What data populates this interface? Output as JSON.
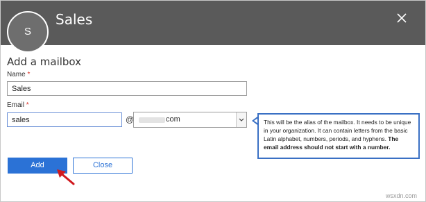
{
  "header": {
    "title": "Sales",
    "avatar_initial": "S",
    "close_icon": "close-icon"
  },
  "form": {
    "title": "Add a mailbox",
    "name_label": "Name",
    "name_value": "Sales",
    "email_label": "Email",
    "email_value": "sales",
    "required_marker": "*",
    "at_symbol": "@",
    "domain_suffix": "com"
  },
  "tooltip": {
    "text_regular": "This will be the alias of the mailbox. It needs to be unique in your organization. It can contain letters from the basic Latin alphabet, numbers, periods, and hyphens. ",
    "text_bold": "The email address should not start with a number."
  },
  "buttons": {
    "add_label": "Add",
    "close_label": "Close"
  },
  "watermark": "wsxdn.com",
  "colors": {
    "header_bg": "#5a5a5a",
    "accent": "#2b72d6",
    "annotation": "#d0191e"
  }
}
